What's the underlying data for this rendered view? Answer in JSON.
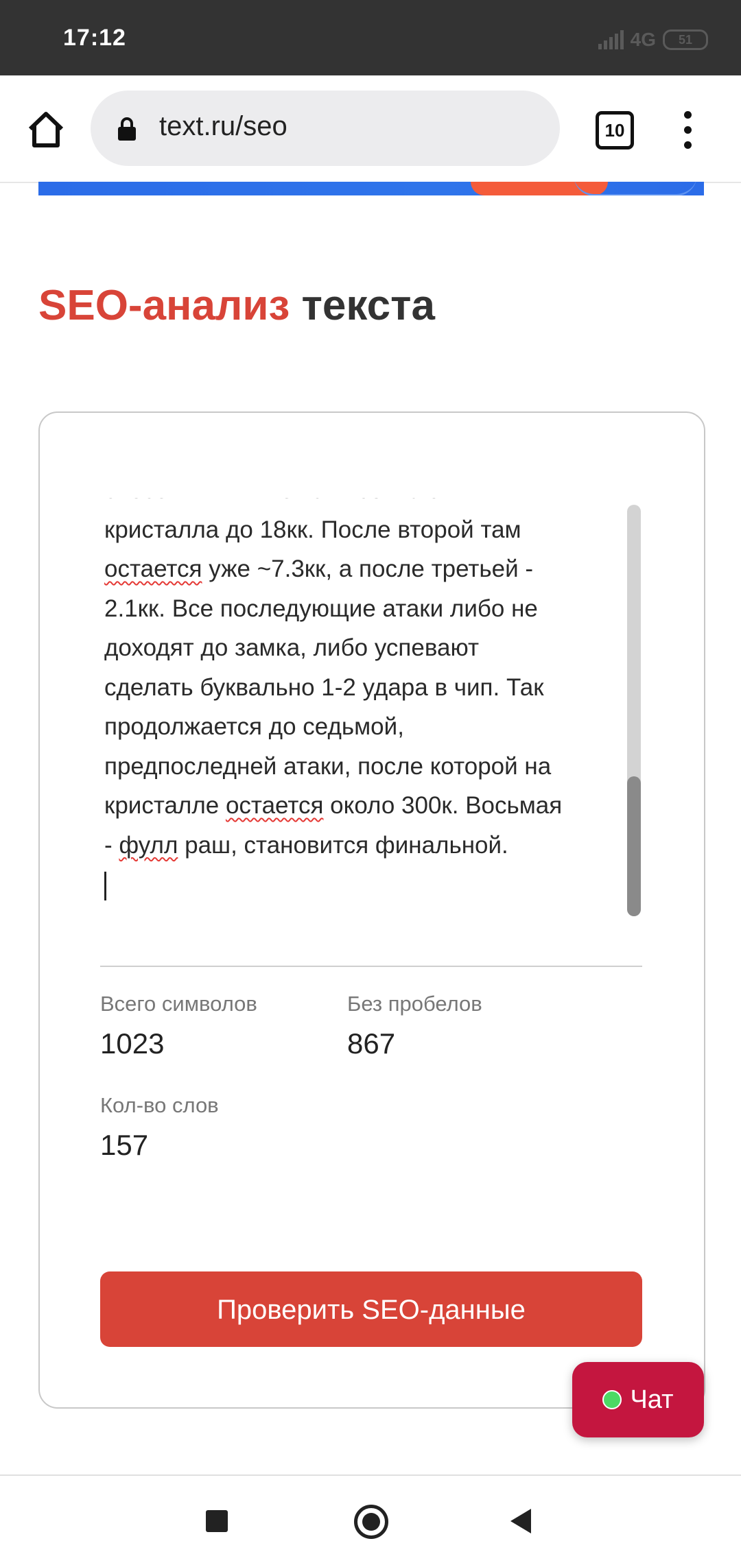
{
  "status_bar": {
    "time": "17:12",
    "network": "4G",
    "battery": "51"
  },
  "browser": {
    "url": "text.ru/seo",
    "tab_count": "10"
  },
  "page": {
    "title_accent": "SEO-анализ",
    "title_rest": "текста"
  },
  "editor": {
    "lines": [
      [
        "снесенных вышек они сбивают ХП"
      ],
      [
        "кристалла до 18кк. После второй там"
      ],
      [
        {
          "sp": "остается"
        },
        " уже ~7.3кк, а после третьей -"
      ],
      [
        "2.1кк. Все последующие атаки либо не"
      ],
      [
        "доходят до замка, либо успевают"
      ],
      [
        "сделать буквально 1-2 удара в чип. Так"
      ],
      [
        "продолжается до седьмой,"
      ],
      [
        "предпоследней атаки, после которой на"
      ],
      [
        "кристалле ",
        {
          "sp": "остается"
        },
        " около 300к. Восьмая"
      ],
      [
        "- ",
        {
          "sp": "фулл"
        },
        " раш, становится финальной."
      ]
    ],
    "scroll_fraction": 0.66
  },
  "stats": {
    "total_label": "Всего символов",
    "total_value": "1023",
    "nospace_label": "Без пробелов",
    "nospace_value": "867",
    "words_label": "Кол-во слов",
    "words_value": "157"
  },
  "actions": {
    "check_label": "Проверить SEO-данные",
    "chat_label": "Чат"
  },
  "colors": {
    "accent": "#d84438",
    "chat": "#c4163f",
    "status_bar": "#333333"
  },
  "icons": [
    "home-icon",
    "lock-icon",
    "tabs-icon",
    "more-vert-icon",
    "recents-icon",
    "home-nav-icon",
    "back-icon"
  ]
}
